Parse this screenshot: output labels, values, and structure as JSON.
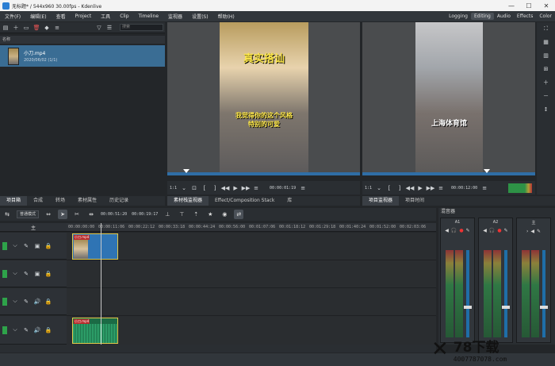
{
  "window": {
    "title": "无标题* / 544x960 30.00fps - Kdenlive",
    "controls": [
      "—",
      "☐",
      "✕"
    ]
  },
  "menu": {
    "items": [
      "文件(F)",
      "编辑(E)",
      "查看",
      "Project",
      "工具",
      "Clip",
      "Timeline",
      "监视器",
      "设置(S)",
      "帮助(H)"
    ]
  },
  "workspaces": {
    "items": [
      "Logging",
      "Editing",
      "Audio",
      "Effects",
      "Color"
    ],
    "active": "Editing"
  },
  "bin": {
    "search_placeholder": "搜索",
    "header": "名称",
    "items": [
      {
        "name": "小刀.mp4",
        "date": "2020/06/02 (1/1)"
      }
    ]
  },
  "clip_monitor": {
    "caption_top": "真实搭讪",
    "caption_bottom": "我觉得你的这个风格\n特别的可爱",
    "zoom": "1:1",
    "timecode": "00:00:01:19"
  },
  "project_monitor": {
    "caption": "上海体育馆",
    "zoom": "1:1",
    "timecode": "00:00:12:00"
  },
  "tabs_left": {
    "items": [
      "项目箱",
      "合成",
      "转场",
      "素材属性",
      "历史记录"
    ],
    "active": "项目箱"
  },
  "tabs_mid": {
    "items": [
      "素材栈监视器",
      "Effect/Composition Stack",
      "库"
    ]
  },
  "tabs_right": {
    "items": [
      "项目监视器",
      "项目时间"
    ],
    "active": "项目监视器"
  },
  "timeline": {
    "mode_label": "普通模式",
    "current_tc": "00:00:51:20",
    "total_tc": "00:00:19:17",
    "ruler": [
      "00:00:00:00",
      "00:00:11:06",
      "00:00:22:12",
      "00:00:33:18",
      "00:00:44:24",
      "00:00:56:00",
      "00:01:07:06",
      "00:01:18:12",
      "00:01:29:18",
      "00:01:40:24",
      "00:01:52:00",
      "00:02:03:06"
    ],
    "master_label": "主",
    "video_clip_name": "小刀.mp4",
    "audio_clip_name": "小刀.mp4"
  },
  "mixer": {
    "title": "混音器",
    "strips": [
      {
        "name": "A1"
      },
      {
        "name": "A2"
      },
      {
        "name": "主"
      }
    ]
  },
  "watermark": {
    "brand": "78下载",
    "url": "4007787078.com"
  }
}
